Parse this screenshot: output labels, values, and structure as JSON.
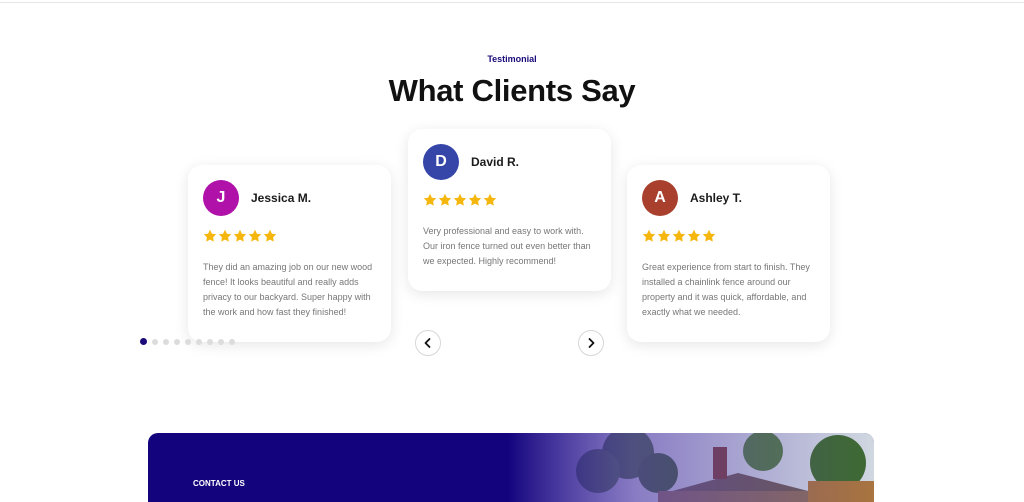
{
  "section": {
    "eyebrow": "Testimonial",
    "title": "What Clients Say"
  },
  "testimonials": [
    {
      "initial": "J",
      "name": "Jessica M.",
      "avatar_color": "#b011a8",
      "rating": 5,
      "text": "They did an amazing job on our new wood fence! It looks beautiful and really adds privacy to our backyard. Super happy with the work and how fast they finished!"
    },
    {
      "initial": "D",
      "name": "David R.",
      "avatar_color": "#3545a8",
      "rating": 5,
      "text": "Very professional and easy to work with. Our iron fence turned out even better than we expected. Highly recommend!"
    },
    {
      "initial": "A",
      "name": "Ashley T.",
      "avatar_color": "#a8402d",
      "rating": 5,
      "text": "Great experience from start to finish. They installed a chainlink fence around our property and it was quick, affordable, and exactly what we needed."
    }
  ],
  "carousel": {
    "page_count": 9,
    "active_index": 0
  },
  "contact": {
    "label": "CONTACT US"
  },
  "colors": {
    "accent": "#1a0a7a",
    "star": "#f5b60d"
  },
  "icons": {
    "prev": "chevron-left-icon",
    "next": "chevron-right-icon",
    "star": "star-icon"
  }
}
